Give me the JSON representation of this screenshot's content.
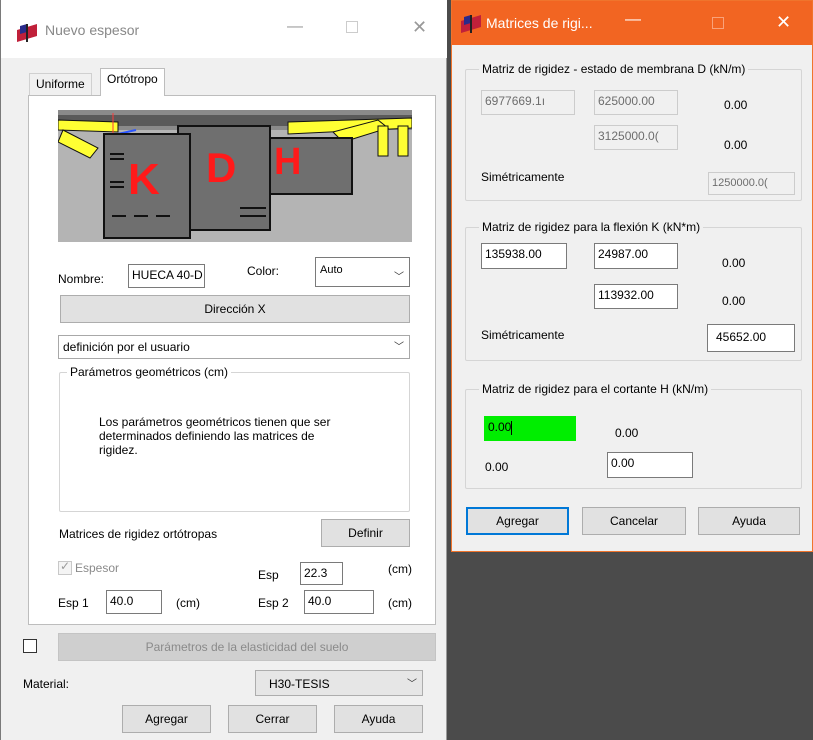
{
  "left_window": {
    "title": "Nuevo espesor",
    "tabs": [
      {
        "label": "Uniforme",
        "active": false
      },
      {
        "label": "Ortótropo",
        "active": true
      }
    ],
    "image_letters": [
      "K",
      "D",
      "H"
    ],
    "nombre_label": "Nombre:",
    "nombre_value": "HUECA 40-D",
    "color_label": "Color:",
    "color_value": "Auto",
    "direction_button": "Dirección X",
    "definition_select": "definición por el usuario",
    "geom_group_title": "Parámetros geométricos (cm)",
    "geom_message": "Los parámetros geométricos tienen que ser determinados definiendo las matrices de rigidez.",
    "matrices_label": "Matrices de rigidez ortótropas",
    "definir_button": "Definir",
    "espesor_checkbox_label": "Espesor",
    "esp_label": "Esp",
    "esp_value": "22.3",
    "esp_unit": "(cm)",
    "esp1_label": "Esp 1",
    "esp1_value": "40.0",
    "esp1_unit": "(cm)",
    "esp2_label": "Esp 2",
    "esp2_value": "40.0",
    "esp2_unit": "(cm)",
    "soil_button": "Parámetros de la elasticidad del suelo",
    "material_label": "Material:",
    "material_value": "H30-TESIS",
    "agregar_button": "Agregar",
    "cerrar_button": "Cerrar",
    "ayuda_button": "Ayuda"
  },
  "right_window": {
    "title": "Matrices de rigi...",
    "membrane": {
      "title": "Matriz de rigidez - estado de membrana D (kN/m)",
      "d11": "6977669.1ı",
      "d12": "625000.00",
      "d13": "0.00",
      "d22": "3125000.0(",
      "d23": "0.00",
      "sym_label": "Simétricamente",
      "d33": "1250000.0("
    },
    "bending": {
      "title": "Matriz de rigidez para la flexión K (kN*m)",
      "k11": "135938.00",
      "k12": "24987.00",
      "k13": "0.00",
      "k22": "113932.00",
      "k23": "0.00",
      "sym_label": "Simétricamente",
      "k33": "45652.00"
    },
    "shear": {
      "title": "Matriz de rigidez para el cortante H (kN/m)",
      "h11": "0.00",
      "h12": "0.00",
      "h21": "0.00",
      "h22": "0.00"
    },
    "agregar_button": "Agregar",
    "cancelar_button": "Cancelar",
    "ayuda_button": "Ayuda"
  },
  "colors": {
    "accent_active_titlebar": "#f26522",
    "focused_field": "#00ee00",
    "image_letters": "#ff1a1a",
    "image_beam": "#ffff33"
  }
}
